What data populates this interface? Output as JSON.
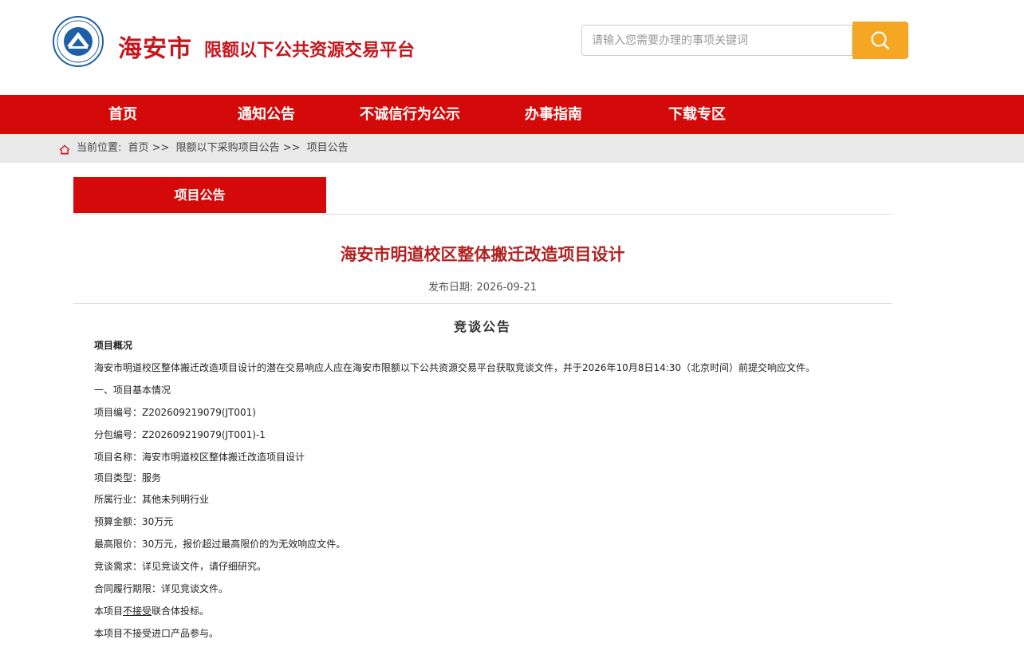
{
  "header": {
    "site_name": "海安市",
    "site_subtitle": "限额以下公共资源交易平台",
    "logo_icon": "city-emblem-icon"
  },
  "search": {
    "placeholder": "请输入您需要办理的事项关键词",
    "button_icon": "search-icon"
  },
  "nav": {
    "items": [
      "首页",
      "通知公告",
      "不诚信行为公示",
      "办事指南",
      "下载专区"
    ]
  },
  "breadcrumb": {
    "prefix": "当前位置:",
    "items": [
      "首页 >>",
      "限额以下采购项目公告 >>",
      "项目公告"
    ]
  },
  "tab": {
    "label": "项目公告"
  },
  "article": {
    "title": "海安市明道校区整体搬迁改造项目设计",
    "publish_date": "发布日期:  2026-09-21",
    "doc_heading": "竞谈公告",
    "overview_heading": "项目概况",
    "lines": [
      "海安市明道校区整体搬迁改造项目设计的潜在交易响应人应在海安市限额以下公共资源交易平台获取竞谈文件，并于2026年10月8日14:30（北京时间）前提交响应文件。",
      "一、项目基本情况",
      "项目编号：Z202609219079(JT001)",
      "分包编号：Z202609219079(JT001)-1",
      "项目名称：海安市明道校区整体搬迁改造项目设计",
      "项目类型：服务",
      "所属行业：其他未列明行业",
      "预算金额：30万元",
      "最高限价：30万元，报价超过最高限价的为无效响应文件。",
      "竞谈需求：详见竞谈文件，请仔细研究。",
      "合同履行期限：详见竞谈文件。"
    ],
    "consortium_prefix": "本项目",
    "consortium_underlined": "不接受",
    "consortium_suffix": "联合体投标。",
    "import_line": "本项目不接受进口产品参与。"
  },
  "colors": {
    "brand_red": "#d40a0a",
    "title_red": "#b22222",
    "search_orange": "#f5a623",
    "breadcrumb_bg": "#e9e9e9"
  }
}
